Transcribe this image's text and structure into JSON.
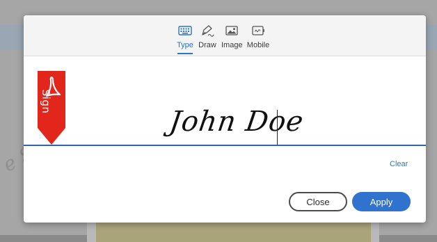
{
  "dialog": {
    "tabs": [
      {
        "label": "Type",
        "icon": "keyboard-icon",
        "active": true
      },
      {
        "label": "Draw",
        "icon": "pen-icon",
        "active": false
      },
      {
        "label": "Image",
        "icon": "image-icon",
        "active": false
      },
      {
        "label": "Mobile",
        "icon": "mobile-icon",
        "active": false
      }
    ],
    "ribbon": {
      "label": "Sign",
      "icon": "acrobat-icon"
    },
    "signature": {
      "value": "John Doe"
    },
    "clear_label": "Clear",
    "buttons": {
      "close_label": "Close",
      "apply_label": "Apply"
    }
  },
  "colors": {
    "accent": "#2a74c9",
    "ribbon": "#e3261c",
    "signature_line": "#2a66b5",
    "apply_button": "#2f73cf"
  }
}
